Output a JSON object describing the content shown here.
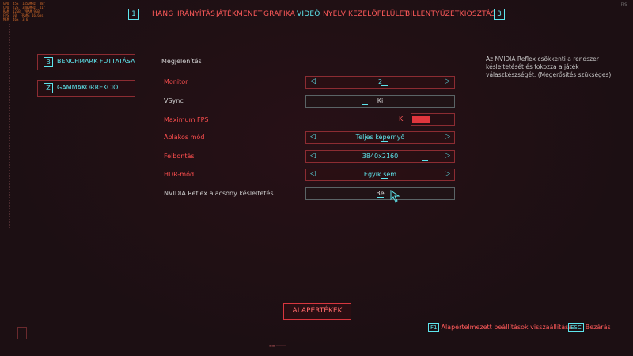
{
  "nav": {
    "left_key": "1",
    "right_key": "3",
    "tabs": [
      {
        "label": "HANG",
        "active": false
      },
      {
        "label": "IRÁNYÍTÁS",
        "active": false
      },
      {
        "label": "JÁTÉKMENET",
        "active": false
      },
      {
        "label": "GRAFIKA",
        "active": false
      },
      {
        "label": "VIDEÓ",
        "active": true
      },
      {
        "label": "NYELV",
        "active": false
      },
      {
        "label": "KEZELŐFELÜLET",
        "active": false
      },
      {
        "label": "BILLENTYŰZETKIOSZTÁS",
        "active": false
      }
    ]
  },
  "sidebar": {
    "benchmark": {
      "key": "B",
      "label": "BENCHMARK FUTTATÁSA"
    },
    "gamma": {
      "key": "Z",
      "label": "GAMMAKORREKCIÓ"
    }
  },
  "section_title": "Megjelenítés",
  "settings": {
    "monitor": {
      "label": "Monitor",
      "value": "2"
    },
    "vsync": {
      "label": "VSync",
      "value": "Ki"
    },
    "max_fps": {
      "label": "Maximum FPS",
      "value": "KI",
      "fill_fraction": 0.42
    },
    "window_mode": {
      "label": "Ablakos mód",
      "value": "Teljes képernyő"
    },
    "resolution": {
      "label": "Felbontás",
      "value": "3840x2160"
    },
    "hdr": {
      "label": "HDR-mód",
      "value": "Egyik sem"
    },
    "reflex": {
      "label": "NVIDIA Reflex alacsony késleltetés",
      "value": "Be"
    }
  },
  "help_text": "Az NVIDIA Reflex csökkenti a rendszer késleltetését és fokozza a játék válaszkészségét. (Megerősítés szükséges)",
  "defaults_button": "ALAPÉRTÉKEK",
  "hints": {
    "reset": {
      "key": "F1",
      "label": "Alapértelmezett beállítások visszaállítása"
    },
    "close": {
      "key": "ESC",
      "label": "Bezárás"
    }
  },
  "colors": {
    "accent_cyan": "#5ee6ee",
    "accent_red": "#ff4f4f",
    "bg": "#1c0f13"
  }
}
